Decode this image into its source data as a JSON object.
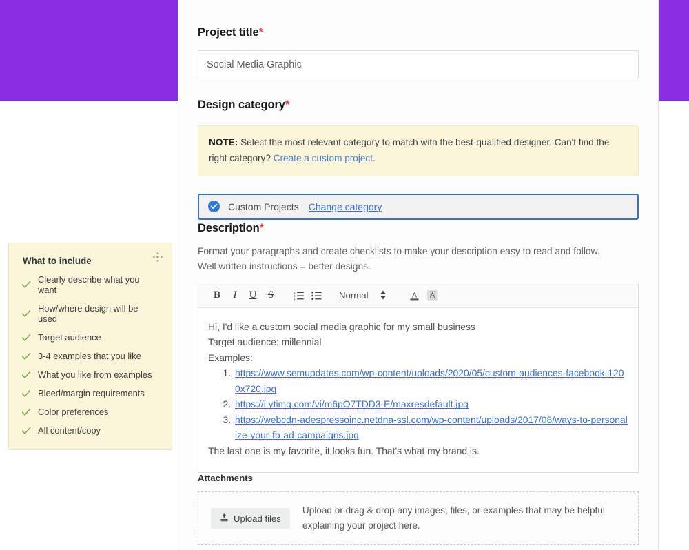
{
  "theme": {
    "banner_color": "#8B2DE2",
    "accent_blue": "#3b6fd4",
    "note_bg": "#fbf6d9",
    "check_green": "#7aab4a",
    "required_red": "#e8453c"
  },
  "project_title": {
    "label": "Project title",
    "required_marker": "*",
    "value": "Social Media Graphic",
    "placeholder": "Social Media Graphic"
  },
  "design_category": {
    "label": "Design category",
    "required_marker": "*",
    "note_prefix": "NOTE:",
    "note_text": " Select the most relevant category to match with the best-qualified designer. Can't find the right category? ",
    "note_link": "Create a custom project",
    "note_suffix": ".",
    "selected_category": "Custom Projects",
    "change_link": "Change category"
  },
  "description": {
    "label": "Description",
    "required_marker": "*",
    "help_text": "Format your paragraphs and create checklists to make your description easy to read and follow. Well written instructions = better designs.",
    "toolbar": {
      "bold": "B",
      "italic": "I",
      "underline": "U",
      "strikethrough": "S",
      "ordered_list": "ordered-list",
      "bullet_list": "bullet-list",
      "block_format": "Normal",
      "text_color": "A",
      "highlight_color": "A"
    },
    "body": {
      "line1": "Hi, I'd like a custom social media graphic for my small business",
      "line2": "Target audience: millennial",
      "line3": "Examples:",
      "links": [
        "https://www.semupdates.com/wp-content/uploads/2020/05/custom-audiences-facebook-1200x720.jpg",
        "https://i.ytimg.com/vi/m6pQ7TDD3-E/maxresdefault.jpg",
        "https://webcdn-adespressoinc.netdna-ssl.com/wp-content/uploads/2017/08/ways-to-personalize-your-fb-ad-campaigns.jpg"
      ],
      "closing": "The last one is my favorite, it looks fun. That's what my brand is."
    }
  },
  "attachments": {
    "label": "Attachments",
    "upload_button": "Upload files",
    "dropzone_text": "Upload or drag & drop any images, files, or examples that may be helpful explaining your project here."
  },
  "what_to_include": {
    "title": "What to include",
    "items": [
      "Clearly describe what you want",
      "How/where design will be used",
      "Target audience",
      "3-4 examples that you like",
      "What you like from examples",
      "Bleed/margin requirements",
      "Color preferences",
      "All content/copy"
    ]
  }
}
